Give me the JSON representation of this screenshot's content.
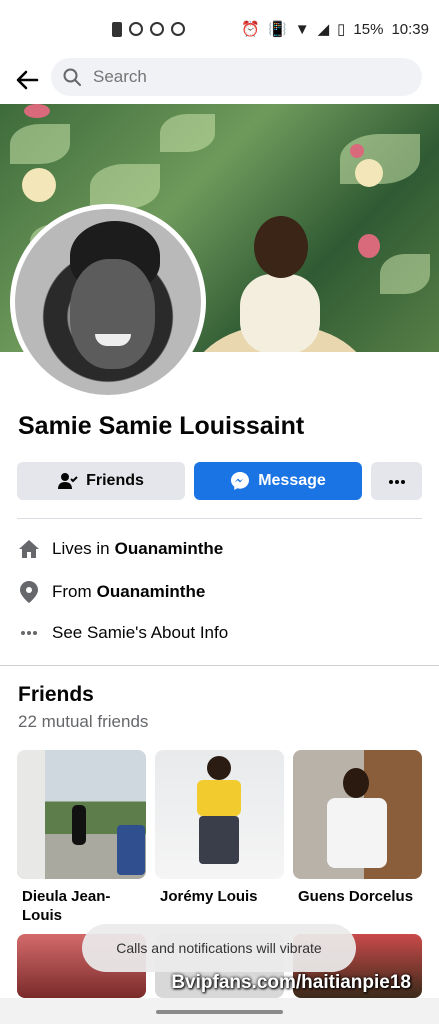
{
  "status_bar": {
    "battery": "15%",
    "time": "10:39"
  },
  "search": {
    "placeholder": "Search"
  },
  "profile": {
    "name": "Samie Samie Louissaint",
    "buttons": {
      "friends": "Friends",
      "message": "Message"
    }
  },
  "info": [
    {
      "prefix": "Lives in",
      "value": "Ouanaminthe",
      "icon": "home-icon"
    },
    {
      "prefix": "From",
      "value": "Ouanaminthe",
      "icon": "location-pin-icon"
    },
    {
      "prefix": "See Samie's About Info",
      "value": "",
      "icon": "more-dots-icon"
    }
  ],
  "friends": {
    "title": "Friends",
    "mutual": "22 mutual friends",
    "items": [
      {
        "name": "Dieula Jean-Louis"
      },
      {
        "name": "Jorémy Louis"
      },
      {
        "name": "Guens Dorcelus"
      }
    ]
  },
  "toast": "Calls and notifications will vibrate",
  "watermark": "Bvipfans.com/haitianpie18",
  "colors": {
    "accent": "#1b74e4",
    "button_gray": "#e4e6eb",
    "search_bg": "#f0f2f5"
  }
}
